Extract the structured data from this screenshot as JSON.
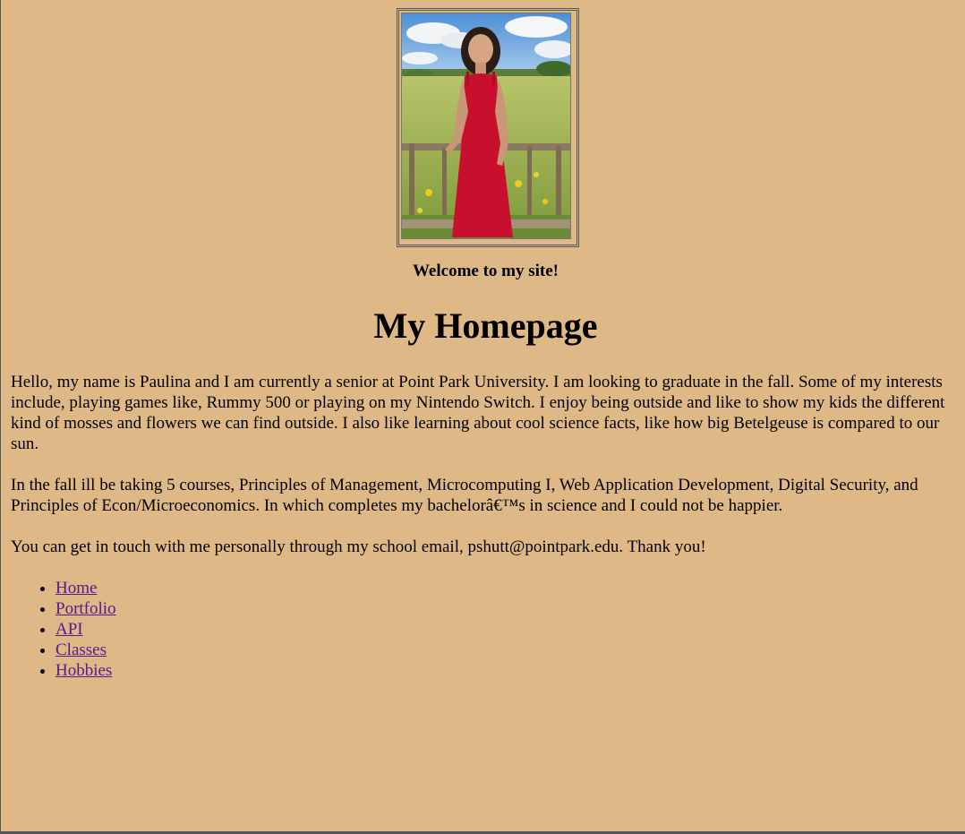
{
  "header": {
    "welcome": "Welcome to my site!",
    "title": "My Homepage"
  },
  "photo": {
    "description": "portrait"
  },
  "intro": {
    "paragraphs": [
      "Hello, my name is Paulina and I am currently a senior at Point Park University. I am looking to graduate in the fall. Some of my interests include, playing games like, Rummy 500 or playing on my Nintendo Switch. I enjoy being outside and like to show my kids the different kind of mosses and flowers we can find outside. I also like learning about cool science facts, like how big Betelgeuse is compared to our sun.",
      "In the fall ill be taking 5 courses, Principles of Management, Microcomputing I, Web Application Development, Digital Security, and Principles of Econ/Microeconomics. In which completes my bachelorâ€™s in science and I could not be happier.",
      "You can get in touch with me personally through my school email, pshutt@pointpark.edu. Thank you!"
    ]
  },
  "nav": {
    "items": [
      {
        "label": "Home"
      },
      {
        "label": "Portfolio"
      },
      {
        "label": "API"
      },
      {
        "label": "Classes"
      },
      {
        "label": "Hobbies"
      }
    ]
  },
  "colors": {
    "background": "#DEB887",
    "link": "#551A8B",
    "dress": "#C8102E"
  }
}
